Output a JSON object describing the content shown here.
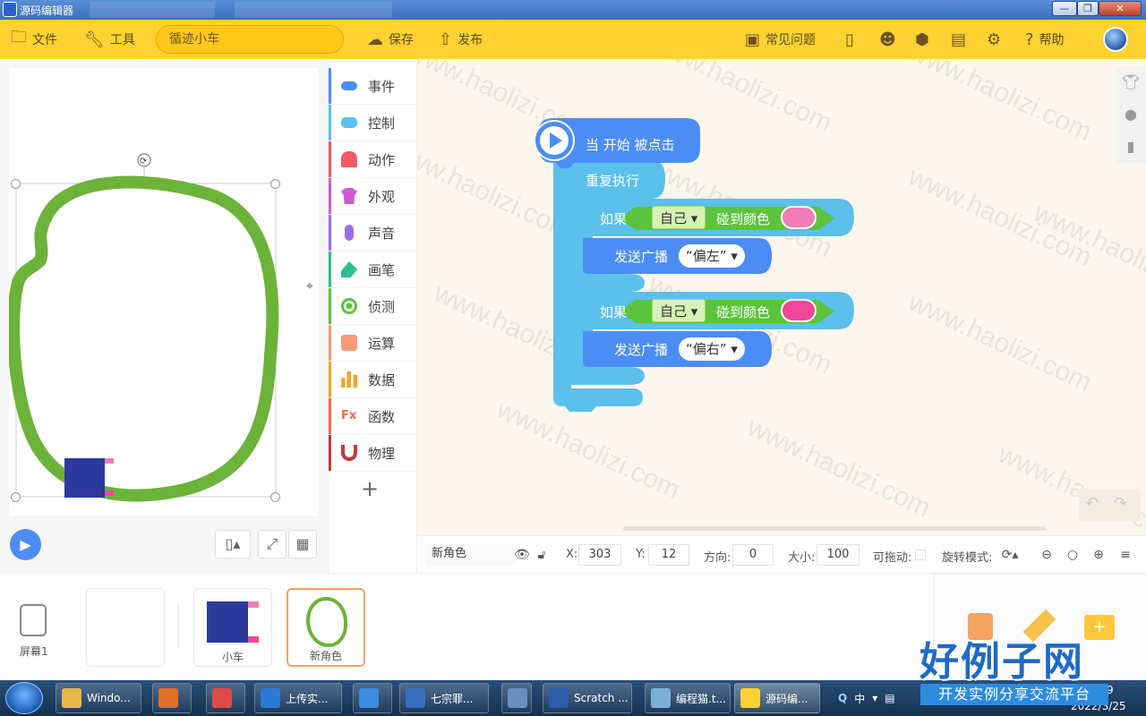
{
  "window": {
    "title": "源码编辑器",
    "controls": [
      "—",
      "❐",
      "✕"
    ]
  },
  "toolbar": {
    "file": "文件",
    "tools": "工具",
    "project_name": "循迹小车",
    "save": "保存",
    "publish": "发布",
    "faq": "常见问题",
    "help": "帮助"
  },
  "categories": [
    {
      "label": "事件",
      "color": "#4b8df5"
    },
    {
      "label": "控制",
      "color": "#5bc0eb"
    },
    {
      "label": "动作",
      "color": "#f25a64"
    },
    {
      "label": "外观",
      "color": "#d05ad6"
    },
    {
      "label": "声音",
      "color": "#9c6cf0"
    },
    {
      "label": "画笔",
      "color": "#2bbf8f"
    },
    {
      "label": "侦测",
      "color": "#5bc43c"
    },
    {
      "label": "运算",
      "color": "#f59b7a"
    },
    {
      "label": "数据",
      "color": "#f5a623"
    },
    {
      "label": "函数",
      "color": "#f26b4a"
    },
    {
      "label": "物理",
      "color": "#c23a3a"
    }
  ],
  "add_category": "+",
  "script": {
    "when_flag": "当 开始 被点击",
    "forever": "重复执行",
    "if_label": "如果",
    "self": "自己",
    "touch_color": "碰到颜色",
    "broadcast": "发送广播",
    "msg_left": "“偏左”",
    "msg_right": "“偏右”",
    "color_left": "#f27cb8",
    "color_right": "#f0469b"
  },
  "watermark": "www.haolizi.com",
  "props": {
    "sprite_name": "新角色",
    "x_label": "X:",
    "x": "303",
    "y_label": "Y:",
    "y": "12",
    "dir_label": "方向:",
    "dir": "0",
    "size_label": "大小:",
    "size": "100",
    "drag_label": "可拖动:",
    "rot_label": "旋转模式:"
  },
  "sprites": {
    "screen_label": "屏幕1",
    "car_label": "小车",
    "new_label": "新角色"
  },
  "taskbar": [
    {
      "label": "Windo...",
      "color": "#e8b84a"
    },
    {
      "label": "",
      "color": "#e0702a"
    },
    {
      "label": "",
      "color": "#e04a4a"
    },
    {
      "label": "上传实...",
      "color": "#2a7bd8"
    },
    {
      "label": "",
      "color": "#3a8de0"
    },
    {
      "label": "七宗罪...",
      "color": "#3a6fc0"
    },
    {
      "label": "",
      "color": "#6a8fc0"
    },
    {
      "label": "Scratch ...",
      "color": "#2a5caa"
    },
    {
      "label": "编程猫.t...",
      "color": "#7ab0d8"
    },
    {
      "label": "源码编...",
      "color": "#ffd231"
    }
  ],
  "tray": {
    "ime": "中",
    "time": "9",
    "date": "2022/3/25"
  },
  "logo": {
    "main": "好例子网",
    "sub": "开发实例分享交流平台"
  }
}
